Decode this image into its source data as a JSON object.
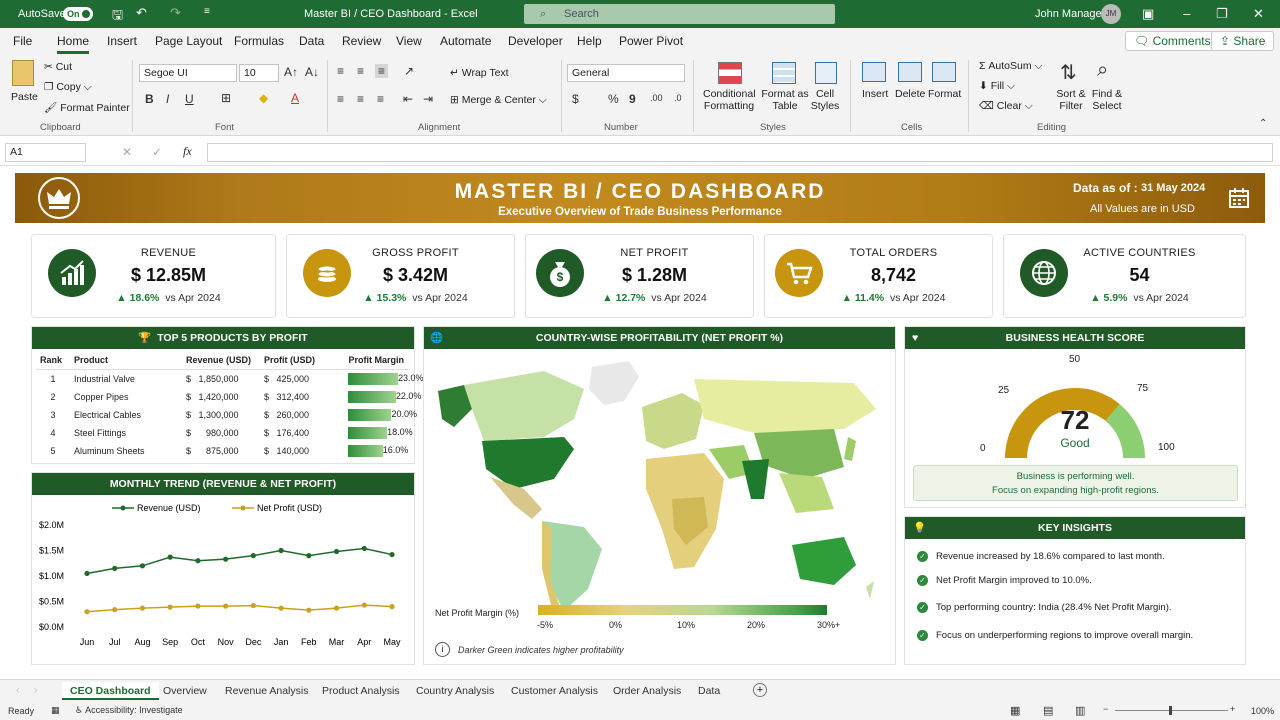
{
  "titlebar": {
    "autosave": "AutoSave",
    "toggle": "On",
    "filename": "Master BI / CEO Dashboard  -  Excel",
    "search_placeholder": "Search",
    "user": "John Manager",
    "initials": "JM"
  },
  "menu": [
    "File",
    "Home",
    "Insert",
    "Page Layout",
    "Formulas",
    "Data",
    "Review",
    "View",
    "Automate",
    "Developer",
    "Help",
    "Power Pivot"
  ],
  "menu_active": "Home",
  "comments": "Comments",
  "share": "Share",
  "ribbon": {
    "paste": "Paste",
    "cut": "Cut",
    "copy": "Copy",
    "format_painter": "Format Painter",
    "clipboard": "Clipboard",
    "font_name": "Segoe UI",
    "font_size": "10",
    "font": "Font",
    "wrap_text": "Wrap Text",
    "merge_center": "Merge & Center",
    "alignment": "Alignment",
    "number_format": "General",
    "number": "Number",
    "cond_format": "Conditional Formatting",
    "format_table": "Format as Table",
    "cell_styles": "Cell Styles",
    "styles": "Styles",
    "insert": "Insert",
    "delete": "Delete",
    "format": "Format",
    "cells": "Cells",
    "autosum": "AutoSum",
    "fill": "Fill",
    "clear": "Clear",
    "sort_filter": "Sort & Filter",
    "find_select": "Find & Select",
    "editing": "Editing"
  },
  "namebox": "A1",
  "banner": {
    "title": "MASTER BI / CEO DASHBOARD",
    "subtitle": "Executive Overview of Trade Business Performance",
    "data_as_of_label": "Data as of :",
    "data_as_of": "31 May 2024",
    "currency_note": "All Values are in USD"
  },
  "kpis": [
    {
      "title": "REVENUE",
      "value": "$ 12.85M",
      "change": "▲ 18.6%",
      "vs": "vs Apr 2024",
      "color": "#1f5a27"
    },
    {
      "title": "GROSS PROFIT",
      "value": "$ 3.42M",
      "change": "▲ 15.3%",
      "vs": "vs Apr 2024",
      "color": "#c8950f"
    },
    {
      "title": "NET PROFIT",
      "value": "$ 1.28M",
      "change": "▲ 12.7%",
      "vs": "vs Apr 2024",
      "color": "#1f5a27"
    },
    {
      "title": "TOTAL ORDERS",
      "value": "8,742",
      "change": "▲ 11.4%",
      "vs": "vs Apr 2024",
      "color": "#c8950f"
    },
    {
      "title": "ACTIVE COUNTRIES",
      "value": "54",
      "change": "▲ 5.9%",
      "vs": "vs Apr 2024",
      "color": "#1f5a27"
    }
  ],
  "top_products": {
    "title": "TOP 5 PRODUCTS BY PROFIT",
    "headers": [
      "Rank",
      "Product",
      "Revenue (USD)",
      "Profit (USD)",
      "Profit Margin"
    ],
    "rows": [
      {
        "rank": "1",
        "product": "Industrial Valve",
        "revenue": "$   1,850,000",
        "profit": "$   425,000",
        "margin": "23.0%",
        "margin_value": 23.0
      },
      {
        "rank": "2",
        "product": "Copper Pipes",
        "revenue": "$   1,420,000",
        "profit": "$   312,400",
        "margin": "22.0%",
        "margin_value": 22.0
      },
      {
        "rank": "3",
        "product": "Electrical Cables",
        "revenue": "$   1,300,000",
        "profit": "$   260,000",
        "margin": "20.0%",
        "margin_value": 20.0
      },
      {
        "rank": "4",
        "product": "Steel Fittings",
        "revenue": "$      980,000",
        "profit": "$   176,400",
        "margin": "18.0%",
        "margin_value": 18.0
      },
      {
        "rank": "5",
        "product": "Aluminum Sheets",
        "revenue": "$      875,000",
        "profit": "$   140,000",
        "margin": "16.0%",
        "margin_value": 16.0
      }
    ]
  },
  "map": {
    "title": "COUNTRY-WISE PROFITABILITY (NET PROFIT %)",
    "legend_label": "Net Profit Margin (%)",
    "legend_ticks": [
      "-5%",
      "0%",
      "10%",
      "20%",
      "30%+"
    ],
    "note": "Darker Green indicates higher profitability"
  },
  "health": {
    "title": "BUSINESS HEALTH SCORE",
    "score": "72",
    "rating": "Good",
    "score_value": 72,
    "ticks": [
      "0",
      "25",
      "50",
      "75",
      "100"
    ],
    "message1": "Business is performing well.",
    "message2": "Focus on expanding high-profit regions."
  },
  "insights": {
    "title": "KEY INSIGHTS",
    "items": [
      "Revenue increased by 18.6% compared to last month.",
      "Net Profit Margin improved to 10.0%.",
      "Top performing country: India (28.4% Net Profit Margin).",
      "Focus on underperforming regions to improve overall margin."
    ]
  },
  "chart_data": {
    "type": "line",
    "title": "MONTHLY TREND (REVENUE & NET PROFIT)",
    "categories": [
      "Jun",
      "Jul",
      "Aug",
      "Sep",
      "Oct",
      "Nov",
      "Dec",
      "Jan",
      "Feb",
      "Mar",
      "Apr",
      "May"
    ],
    "series": [
      {
        "name": "Revenue (USD)",
        "color": "#1f6a2b",
        "values": [
          1.05,
          1.15,
          1.2,
          1.37,
          1.3,
          1.33,
          1.4,
          1.5,
          1.4,
          1.48,
          1.54,
          1.42
        ]
      },
      {
        "name": "Net Profit (USD)",
        "color": "#c9a11a",
        "values": [
          0.3,
          0.34,
          0.37,
          0.39,
          0.41,
          0.41,
          0.42,
          0.37,
          0.33,
          0.37,
          0.43,
          0.4
        ]
      }
    ],
    "yticks": [
      "$0.0M",
      "$0.5M",
      "$1.0M",
      "$1.5M",
      "$2.0M"
    ],
    "ylim": [
      0,
      2.0
    ]
  },
  "sheets": [
    "CEO Dashboard",
    "Overview",
    "Revenue Analysis",
    "Product Analysis",
    "Country Analysis",
    "Customer Analysis",
    "Order Analysis",
    "Data"
  ],
  "status": {
    "ready": "Ready",
    "accessibility": "Accessibility: Investigate",
    "zoom": "100%"
  }
}
